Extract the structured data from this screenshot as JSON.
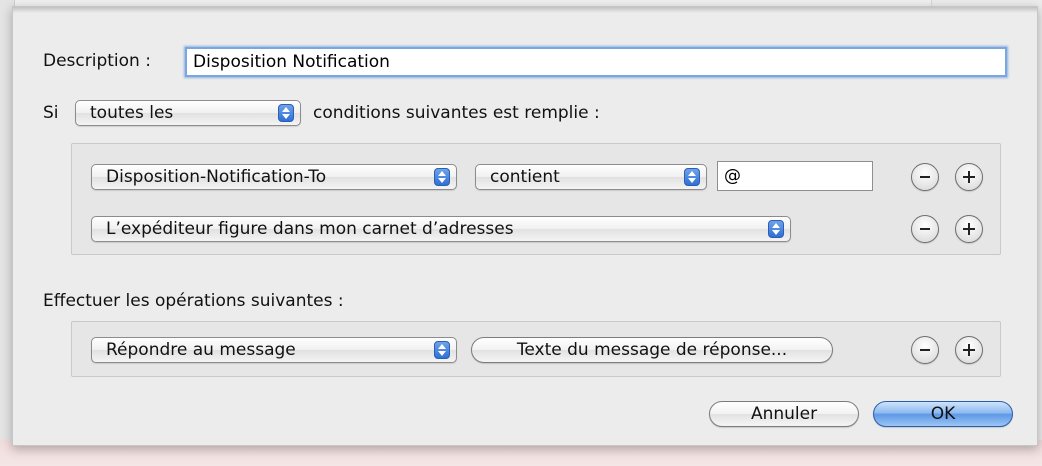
{
  "dialog": {
    "description_label": "Description :",
    "description_value": "Disposition Notification",
    "if_label": "Si",
    "if_popup_value": "toutes les",
    "conditions_label": "conditions suivantes est remplie :",
    "conditions": [
      {
        "header_value": "Disposition-Notification-To",
        "operator_value": "contient",
        "text_value": "@"
      },
      {
        "header_value": "L’expéditeur figure dans mon carnet d’adresses"
      }
    ],
    "actions_label": "Effectuer les opérations suivantes :",
    "actions": [
      {
        "action_value": "Répondre au message",
        "button_label": "Texte du message de réponse..."
      }
    ],
    "cancel_label": "Annuler",
    "ok_label": "OK"
  },
  "colors": {
    "focus_ring": "#7aa7e1",
    "default_button": "#5e98e6",
    "popup_arrows": "#2f6fd6"
  }
}
